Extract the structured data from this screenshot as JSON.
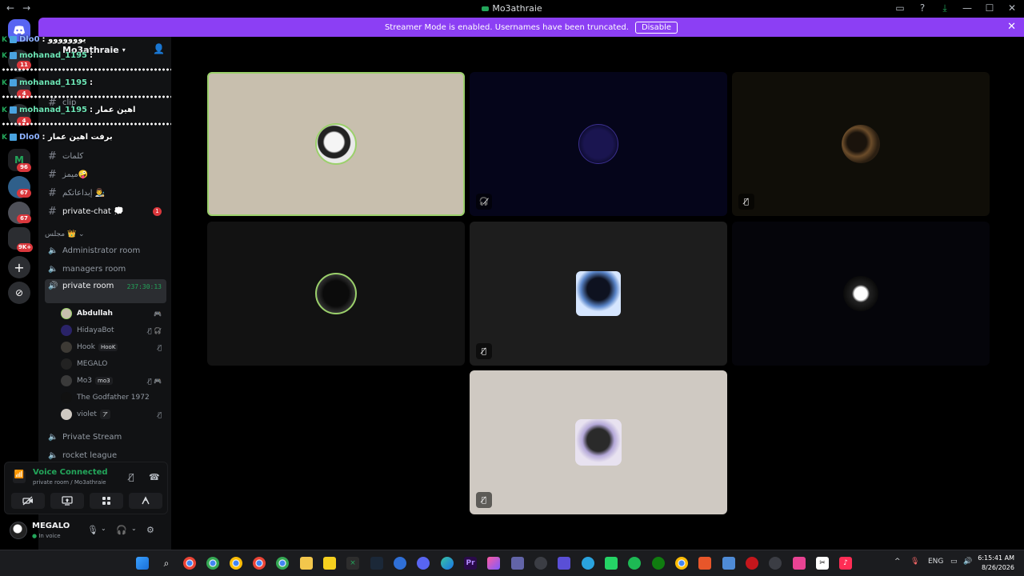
{
  "window": {
    "title": "Mo3athraie",
    "nav_back": "←",
    "nav_forward": "→",
    "controls": [
      "▭",
      "?",
      "⤓",
      "—",
      "☐",
      "✕"
    ]
  },
  "banner": {
    "text": "Streamer Mode is enabled. Usernames have been truncated.",
    "button": "Disable",
    "close": "✕"
  },
  "guild_bar": {
    "home_icon": "discord-logo-icon",
    "badges": [
      "11",
      "4",
      "4",
      "96",
      "67",
      "67",
      "9K+"
    ],
    "add_server": "+",
    "explore": "⊘"
  },
  "overlay": {
    "lines": [
      {
        "name": "Dlo0",
        "msg": ": يووووووو"
      },
      {
        "name": "mohanad_1195",
        "msg": ":"
      },
      {
        "name": "mohanad_1195",
        "msg": ":"
      },
      {
        "name": "mohanad_1195",
        "msg": ": اهين عمار"
      },
      {
        "name": "Dlo0",
        "msg": ": برفت اهين عمار"
      }
    ]
  },
  "sidebar": {
    "server_name": "Mo3athraie",
    "add_user_icon": "add-user-icon",
    "text_channels": [
      {
        "name": "clip",
        "mention": ""
      },
      {
        "name": "كلمات",
        "mention": ""
      },
      {
        "name": "ميمز🤪",
        "mention": ""
      },
      {
        "name": "إبداعاتكم 👨‍🎨",
        "mention": ""
      },
      {
        "name": "private-chat 💭",
        "mention": "1"
      }
    ],
    "voice_category": "مجلس 👑",
    "voice_channels": [
      {
        "name": "Administrator room"
      },
      {
        "name": "managers room"
      },
      {
        "name": "private room",
        "timer": "237:30:13"
      },
      {
        "name": "Private Stream"
      },
      {
        "name": "rocket league"
      }
    ],
    "members": [
      {
        "name": "Abdullah",
        "tag": "",
        "icons": "🎮"
      },
      {
        "name": "HidayaBot",
        "tag": "",
        "icons": "🎙̸ 🎧̸"
      },
      {
        "name": "Hook",
        "tag": "HooK",
        "icons": "🎙̸"
      },
      {
        "name": "MEGALO",
        "tag": "",
        "icons": ""
      },
      {
        "name": "Mo3",
        "tag": "mo3",
        "icons": "🎙̸ 🎮"
      },
      {
        "name": "The Godfather 1972",
        "tag": "",
        "icons": ""
      },
      {
        "name": "violet",
        "tag": "ア",
        "icons": "🎙̸"
      }
    ]
  },
  "voice_panel": {
    "title": "Voice Connected",
    "subtitle": "private room / Mo3athraie",
    "buttons": [
      "camera-off",
      "screen-share",
      "activities",
      "soundboard"
    ]
  },
  "user_panel": {
    "name": "MEGALO",
    "status": "In voice",
    "controls": [
      "🎙",
      "⌄",
      "🎧",
      "⌄",
      "⚙"
    ]
  },
  "taskbar": {
    "language": "ENG",
    "time": "6:15:41 AM",
    "date": "8/26/2026"
  },
  "colors": {
    "accent_banner": "#8c3ff4",
    "voice_green": "#23a55a",
    "mention_red": "#da373c",
    "speaking_border": "#9bd06b"
  }
}
